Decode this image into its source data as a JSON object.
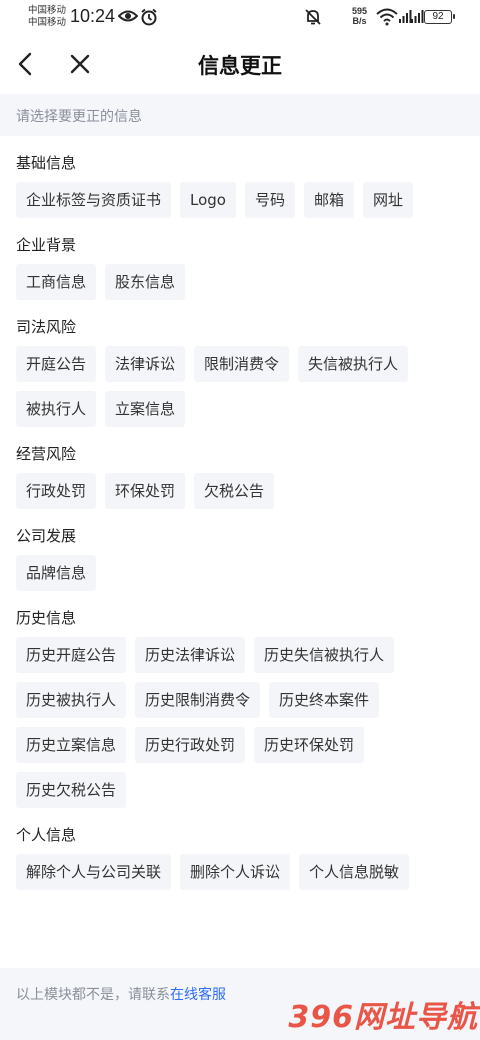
{
  "status_bar": {
    "carrier_1": "中国移动",
    "carrier_2": "中国移动",
    "time": "10:24",
    "net_speed_value": "595",
    "net_speed_unit": "B/s",
    "battery": "92",
    "icons": [
      "eye-icon",
      "alarm-icon",
      "mute-icon",
      "wifi-icon",
      "signal-icon",
      "signal-icon",
      "battery-icon"
    ]
  },
  "nav": {
    "title": "信息更正"
  },
  "hint": "请选择要更正的信息",
  "sections": [
    {
      "title": "基础信息",
      "items": [
        "企业标签与资质证书",
        "Logo",
        "号码",
        "邮箱",
        "网址"
      ]
    },
    {
      "title": "企业背景",
      "items": [
        "工商信息",
        "股东信息"
      ]
    },
    {
      "title": "司法风险",
      "items": [
        "开庭公告",
        "法律诉讼",
        "限制消费令",
        "失信被执行人",
        "被执行人",
        "立案信息"
      ]
    },
    {
      "title": "经营风险",
      "items": [
        "行政处罚",
        "环保处罚",
        "欠税公告"
      ]
    },
    {
      "title": "公司发展",
      "items": [
        "品牌信息"
      ]
    },
    {
      "title": "历史信息",
      "items": [
        "历史开庭公告",
        "历史法律诉讼",
        "历史失信被执行人",
        "历史被执行人",
        "历史限制消费令",
        "历史终本案件",
        "历史立案信息",
        "历史行政处罚",
        "历史环保处罚",
        "历史欠税公告"
      ]
    },
    {
      "title": "个人信息",
      "items": [
        "解除个人与公司关联",
        "删除个人诉讼",
        "个人信息脱敏"
      ]
    }
  ],
  "footer": {
    "text": "以上模块都不是，请联系",
    "link": "在线客服"
  },
  "watermark": "396网址导航",
  "colors": {
    "accent": "#2f6df6",
    "chip_bg": "#f3f5f8",
    "hint_bg": "#f4f6fa",
    "watermark": "#e84434"
  }
}
